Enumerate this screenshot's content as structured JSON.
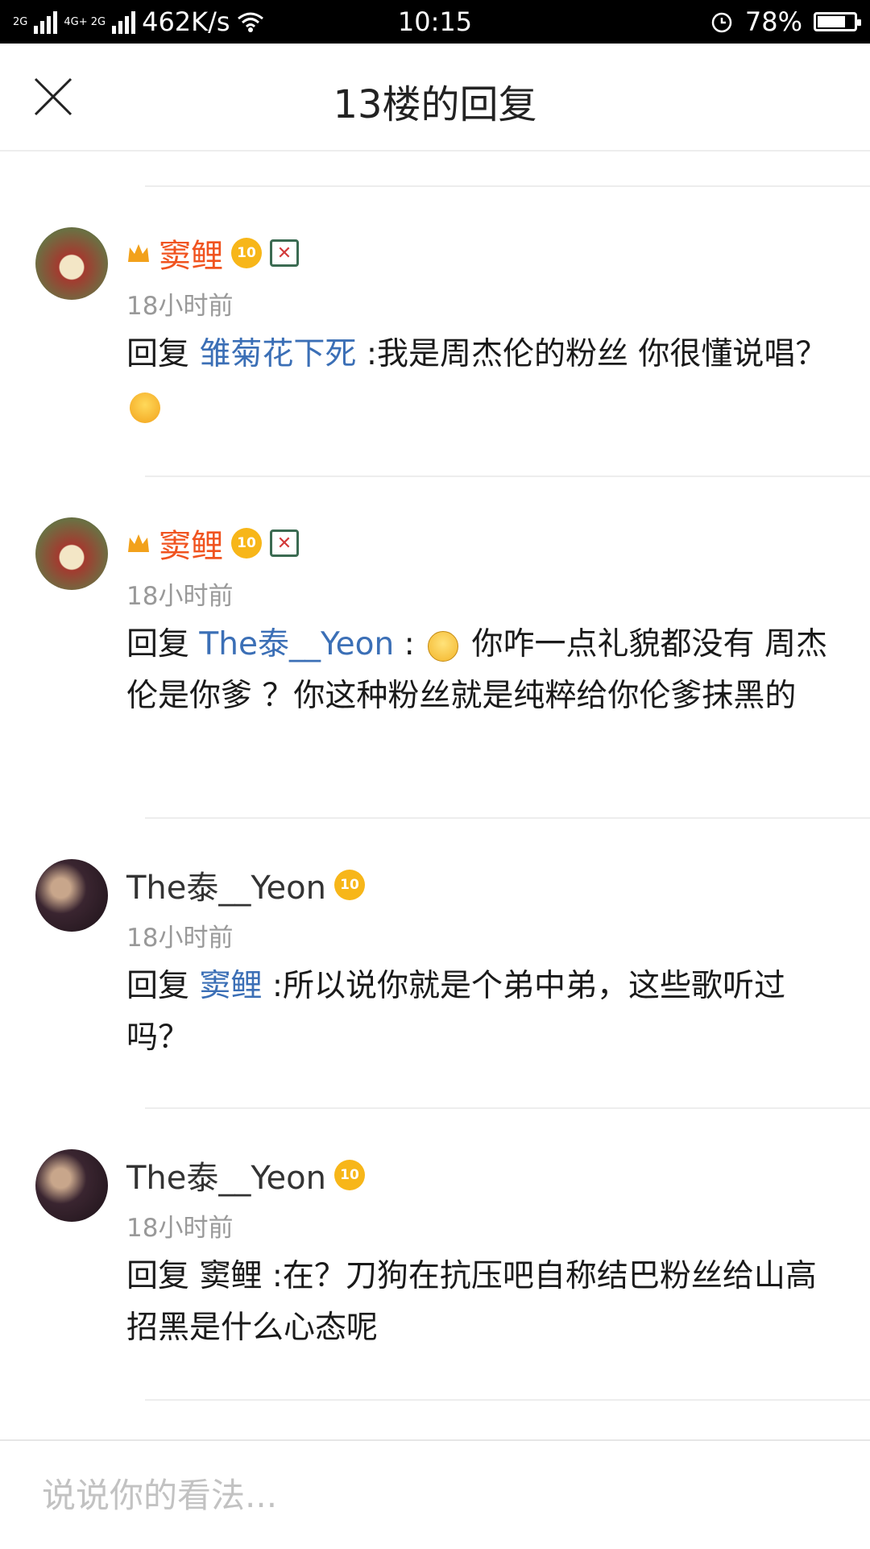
{
  "status_bar": {
    "network_left": "2G",
    "network_mid": "4G+ 2G",
    "speed": "462K/s",
    "time": "10:15",
    "battery": "78%",
    "battery_level": 0.78
  },
  "header": {
    "title": "13楼的回复"
  },
  "replies": [
    {
      "name": "窦鲤",
      "level": "10",
      "time": "18小时前",
      "prefix": "回复",
      "mention": "雏菊花下死",
      "text": " :我是周杰伦的粉丝 你很懂说唱？"
    },
    {
      "name": "窦鲤",
      "level": "10",
      "time": "18小时前",
      "prefix": "回复",
      "mention": "The泰__Yeon",
      "text_before": " :",
      "text": "你咋一点礼貌都没有 周杰伦是你爹 ？你这种粉丝就是纯粹给你伦爹抹黑的"
    },
    {
      "name": "The泰__Yeon",
      "level": "10",
      "time": "18小时前",
      "prefix": "回复",
      "mention": "窦鲤",
      "text": " :所以说你就是个弟中弟，这些歌听过吗？"
    },
    {
      "name": "The泰__Yeon",
      "level": "10",
      "time": "18小时前",
      "text": "回复 窦鲤 :在？刀狗在抗压吧自称结巴粉丝给山高招黑是什么心态呢"
    }
  ],
  "input": {
    "placeholder": "说说你的看法..."
  },
  "colors": {
    "vip_name": "#f0531f",
    "mention": "#3b6fb6",
    "meta": "#999999"
  },
  "icons": {
    "close": "close-icon",
    "crown": "crown-icon",
    "level_badge": "level-badge-icon",
    "member_badge": "member-badge-icon",
    "emoji_yum": "yum-emoji-icon",
    "emoji_shock": "shocked-emoji-icon"
  }
}
